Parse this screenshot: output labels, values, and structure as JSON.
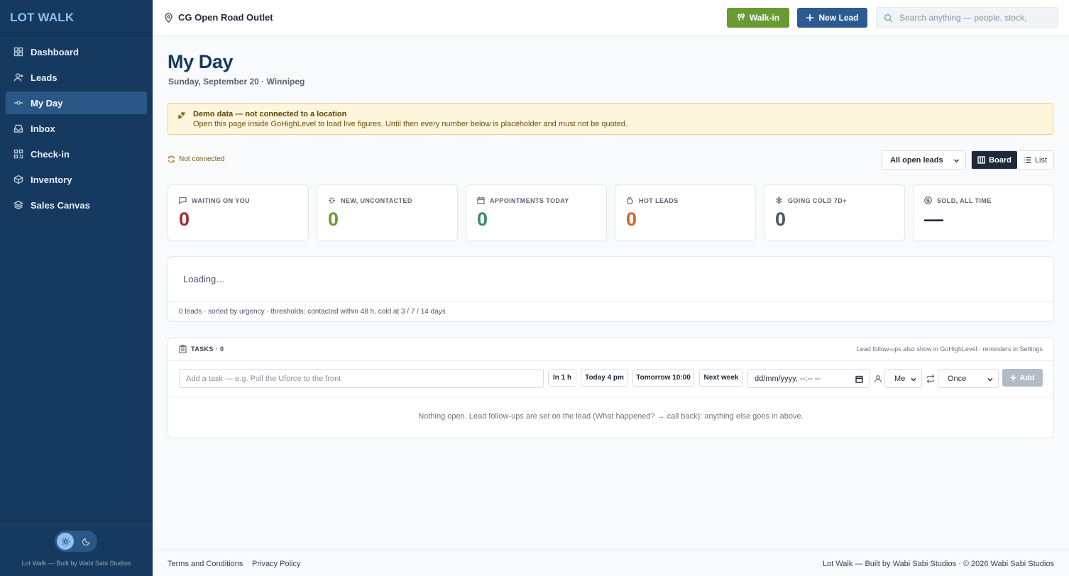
{
  "sidebar": {
    "brand": "LOT WALK",
    "items": [
      {
        "label": "Dashboard",
        "icon": "grid-icon"
      },
      {
        "label": "Leads",
        "icon": "user-plus-icon"
      },
      {
        "label": "My Day",
        "icon": "commit-icon",
        "active": true
      },
      {
        "label": "Inbox",
        "icon": "inbox-icon"
      },
      {
        "label": "Check-in",
        "icon": "qr-icon"
      },
      {
        "label": "Inventory",
        "icon": "box-icon"
      },
      {
        "label": "Sales Canvas",
        "icon": "layers-icon"
      }
    ],
    "credit": "Lot Walk — Built by Wabi Sabi Studios",
    "theme": {
      "light_icon": "sun-icon",
      "dark_icon": "moon-icon",
      "active": "light"
    }
  },
  "topbar": {
    "location": "CG Open Road Outlet",
    "walkin_label": "Walk-in",
    "newlead_label": "New Lead",
    "search_placeholder": "Search anything — people, stock,"
  },
  "page": {
    "title": "My Day",
    "subtitle": "Sunday, September 20 · Winnipeg"
  },
  "banner": {
    "title": "Demo data — not connected to a location",
    "text": "Open this page inside GoHighLevel to load live figures. Until then every number below is placeholder and must not be quoted."
  },
  "status": {
    "label": "Not connected"
  },
  "controls": {
    "filter_value": "All open leads",
    "board_label": "Board",
    "list_label": "List"
  },
  "kpis": [
    {
      "label": "WAITING ON YOU",
      "value": "0",
      "color": "#a32d2d",
      "icon": "message-icon"
    },
    {
      "label": "NEW, UNCONTACTED",
      "value": "0",
      "color": "#6a9a32",
      "icon": "sparkle-icon"
    },
    {
      "label": "APPOINTMENTS TODAY",
      "value": "0",
      "color": "#3d8a6e",
      "icon": "calendar-icon"
    },
    {
      "label": "HOT LEADS",
      "value": "0",
      "color": "#d2622a",
      "icon": "flame-icon"
    },
    {
      "label": "GOING COLD 7D+",
      "value": "0",
      "color": "#4b5563",
      "icon": "snowflake-icon"
    },
    {
      "label": "SOLD, ALL TIME",
      "value": "—",
      "color": "#1e2a3a",
      "icon": "dollar-icon"
    }
  ],
  "board": {
    "loading": "Loading…",
    "footer": "0 leads · sorted by urgency · thresholds: contacted within 48 h, cold at 3 / 7 / 14 days"
  },
  "tasks": {
    "title": "TASKS · 0",
    "note": "Lead follow-ups also show in GoHighLevel · reminders in Settings",
    "input_placeholder": "Add a task — e.g. Pull the Uforce to the front",
    "quick": [
      "In 1 h",
      "Today 4 pm",
      "Tomorrow 10:00",
      "Next week"
    ],
    "date_placeholder": "dd/mm/yyyy, --:-- --",
    "assignee": "Me",
    "repeat": "Once",
    "add_label": "Add",
    "empty": "Nothing open. Lead follow-ups are set on the lead (What happened? → call back); anything else goes in above."
  },
  "footer": {
    "terms": "Terms and Conditions",
    "privacy": "Privacy Policy",
    "credit": "Lot Walk — Built by Wabi Sabi Studios · © 2026 Wabi Sabi Studios"
  }
}
